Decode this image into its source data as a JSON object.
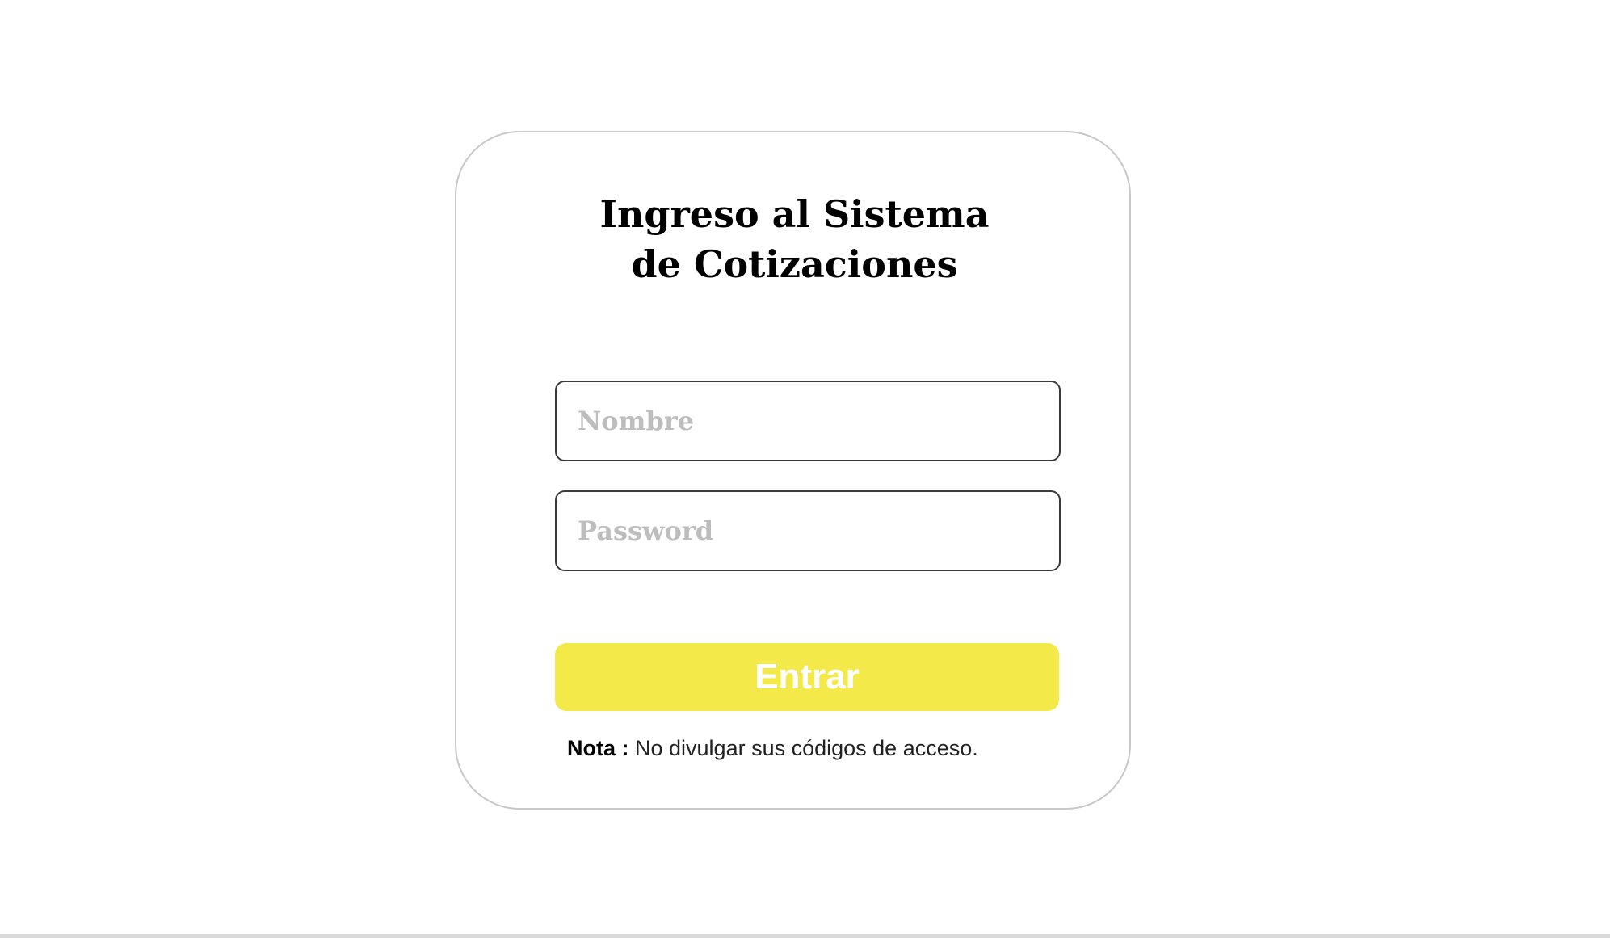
{
  "login": {
    "title_line1": "Ingreso al Sistema",
    "title_line2": "de Cotizaciones",
    "username_placeholder": "Nombre",
    "password_placeholder": "Password",
    "submit_label": "Entrar",
    "note_label": "Nota :",
    "note_text": " No divulgar sus códigos de acceso."
  },
  "colors": {
    "button_background": "#f3ea4a",
    "button_text": "#ffffff",
    "card_border": "#c8c8c8",
    "placeholder_text": "#bdbdbd"
  }
}
